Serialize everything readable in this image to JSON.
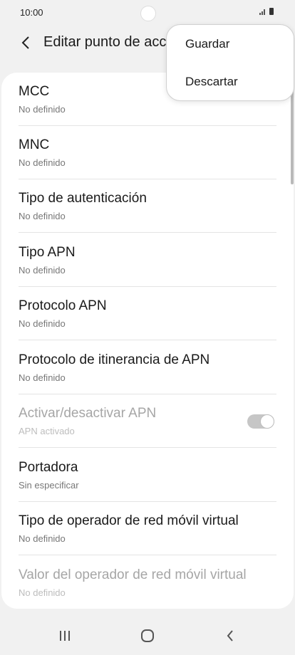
{
  "status_bar": {
    "time": "10:00"
  },
  "header": {
    "title": "Editar punto de acc"
  },
  "menu": {
    "items": [
      {
        "label": "Guardar"
      },
      {
        "label": "Descartar"
      }
    ]
  },
  "settings": [
    {
      "title": "MCC",
      "value": "No definido"
    },
    {
      "title": "MNC",
      "value": "No definido"
    },
    {
      "title": "Tipo de autenticación",
      "value": "No definido"
    },
    {
      "title": "Tipo APN",
      "value": "No definido"
    },
    {
      "title": "Protocolo APN",
      "value": "No definido"
    },
    {
      "title": "Protocolo de itinerancia de APN",
      "value": "No definido"
    },
    {
      "title": "Activar/desactivar APN",
      "value": "APN activado",
      "toggle_on": true,
      "disabled": true
    },
    {
      "title": "Portadora",
      "value": "Sin especificar"
    },
    {
      "title": "Tipo de operador de red móvil virtual",
      "value": "No definido"
    },
    {
      "title": "Valor del operador de red móvil virtual",
      "value": "No definido",
      "disabled": true
    }
  ],
  "colors": {
    "background": "#f1f1f1",
    "card": "#ffffff",
    "disabled_text": "#a6a6a6"
  },
  "icons": {
    "back": "chevron-left-icon",
    "recents": "recents-icon",
    "home": "home-icon",
    "nav_back": "nav-back-icon"
  }
}
